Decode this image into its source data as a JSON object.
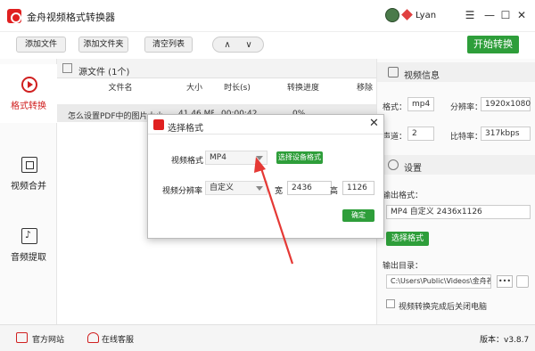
{
  "app": {
    "title": "金舟视频格式转换器",
    "user": "Lyan"
  },
  "window_controls": [
    "☰",
    "—",
    "☐",
    "✕"
  ],
  "toolbar": {
    "add_file": "添加文件",
    "add_folder": "添加文件夹",
    "clear_list": "清空列表",
    "up": "∧",
    "down": "∨",
    "start": "开始转换"
  },
  "sidebar": {
    "items": [
      {
        "label": "格式转换"
      },
      {
        "label": "视频合并"
      },
      {
        "label": "音频提取"
      }
    ]
  },
  "files": {
    "header": "源文件 (1个)",
    "columns": [
      "文件名",
      "大小",
      "时长(s)",
      "转换进度",
      "移除"
    ],
    "row": {
      "name": "怎么设置PDF中的图片大小",
      "size": "41.46 MB",
      "duration": "00:00:42",
      "progress": "0%"
    }
  },
  "right_panel": {
    "info_title": "视频信息",
    "format_label": "格式：",
    "format_value": "mp4",
    "resolution_label": "分辨率：",
    "resolution_value": "1920x1080",
    "channel_label": "声道：",
    "channel_value": "2",
    "bitrate_label": "比特率：",
    "bitrate_value": "317kbps",
    "settings_title": "设置",
    "output_format_label": "输出格式：",
    "output_format_value": "MP4 自定义 2436x1126",
    "select_format_btn": "选择格式",
    "output_dir_label": "输出目录：",
    "output_dir_value": "C:\\Users\\Public\\Videos\\金舟视",
    "more_btn": "•••",
    "shutdown_label": "视频转换完成后关闭电脑"
  },
  "statusbar": {
    "website": "官方网站",
    "service": "在线客服",
    "version": "版本：v3.8.7"
  },
  "dialog": {
    "title": "选择格式",
    "close": "✕",
    "video_format_label": "视频格式",
    "video_format_value": "MP4",
    "device_format_btn": "选择设备格式",
    "resolution_label": "视频分辨率",
    "resolution_value": "自定义",
    "width_label": "宽",
    "width_value": "2436",
    "height_label": "高",
    "height_value": "1126",
    "ok_btn": "确定"
  },
  "colors": {
    "accent_green": "#2e9e3a",
    "brand_red": "#d02020",
    "arrow_red": "#e53935"
  }
}
